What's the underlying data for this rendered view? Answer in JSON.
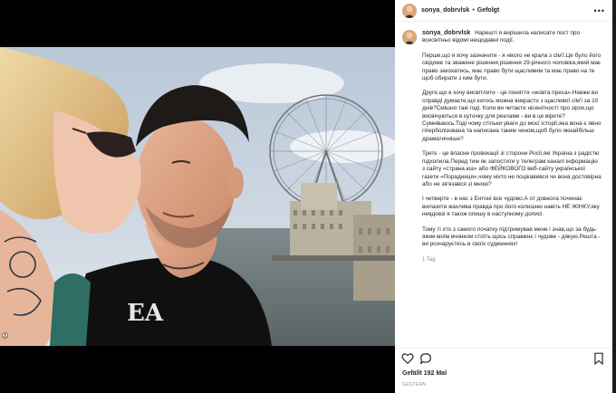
{
  "post": {
    "username": "sonya_dobrvlsk",
    "separator": "•",
    "follow_status": "Gefolgt",
    "more_icon": "more-horizontal-icon"
  },
  "caption": {
    "username": "sonya_dobrvlsk",
    "intro": "Нарешті я вирішила написати пост про всесвітньо відомі нещодавні події.",
    "paragraphs": [
      "Перше,що я хочу зазначити - я нікого не крала з сім'ї.Це було його свідоме та зважене рішення,рішення 29-річного чоловіка,який має право закохатись, має право бути щасливим та має право на те щоб обирати з ким бути.",
      "Друге,що я хочу висвітлити - це поняття «жовта преса».Невже ви справді думаєте,що когось можна викрасти з щасливої сім'ї за 10 днів?Смішно такі годі. Коли ви читаєте нісенітності про зірок,що висвічуються в куточку для реклами - ви в це вірите?Сумніваюсь.Тоді чому стільки уваги до моєї історії,яка вона є явно гіперболізована та написана таким чином,щоб було якнайбільш драматичніше?",
      "Третє - це власне провокації зі сторони Росії,які Україна з радістю підхопила.Перед тим як запостити у телеграм каналі інформацію з сайту «страна.юа» або ФЕЙКОВОГО веб-сайту української газети «Порадниця»,чому ніхто не поцікавився чи вона достовірна або не зв'язався зі мною?",
      "І четверте - в нас з Ентоні все чудово.А от довкола починає вилазити жахлива правда про його колишню навіть НЕ ЖІНКУ,яку невдовзі я також опишу в наступному дописі.",
      "Тому ті хто з самого початку підтримував мене і знав,що за будь-яким моїм вчинком стоїть щось справжнє і чудове - дякую.Решта - ви розчаруєтесь в своїх судженнях!"
    ],
    "tag_count": "1 Tag"
  },
  "actions": {
    "like_icon": "heart-icon",
    "comment_icon": "comment-icon",
    "share_icon": "share-icon",
    "save_icon": "bookmark-icon"
  },
  "likes": "Gefällt 192 Mal",
  "date": "GESTERN",
  "colors": {
    "text": "#262626",
    "secondary": "#8e8e8e",
    "background": "#000000",
    "panel": "#ffffff"
  }
}
